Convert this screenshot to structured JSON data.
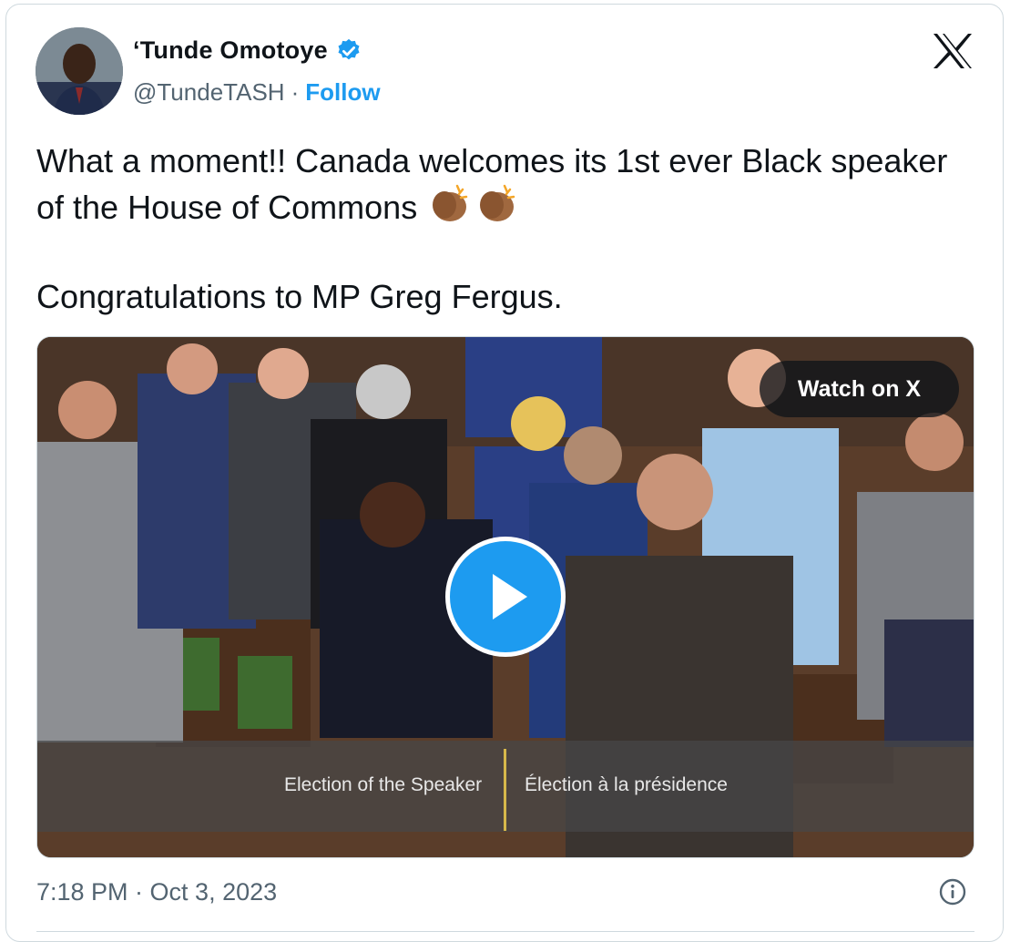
{
  "author": {
    "name": "‘Tunde Omotoye",
    "handle": "@TundeTASH",
    "separator": "·",
    "follow_label": "Follow"
  },
  "tweet": {
    "line1": "What a moment!! Canada welcomes its 1st ever Black speaker of the House of Commons",
    "emoji": "👏🏾👏🏾",
    "line2": "Congratulations to MP Greg Fergus."
  },
  "media": {
    "watch_label": "Watch on X",
    "caption_en": "Election of the Speaker",
    "caption_fr": "Élection à la présidence"
  },
  "footer": {
    "timestamp": "7:18 PM · Oct 3, 2023"
  },
  "colors": {
    "accent": "#1d9bf0",
    "text": "#0f1419",
    "muted": "#536471",
    "border": "#cfd9de"
  },
  "icons": {
    "verified": "verified-badge-icon",
    "platform": "x-logo-icon",
    "play": "play-icon",
    "info": "info-icon"
  }
}
